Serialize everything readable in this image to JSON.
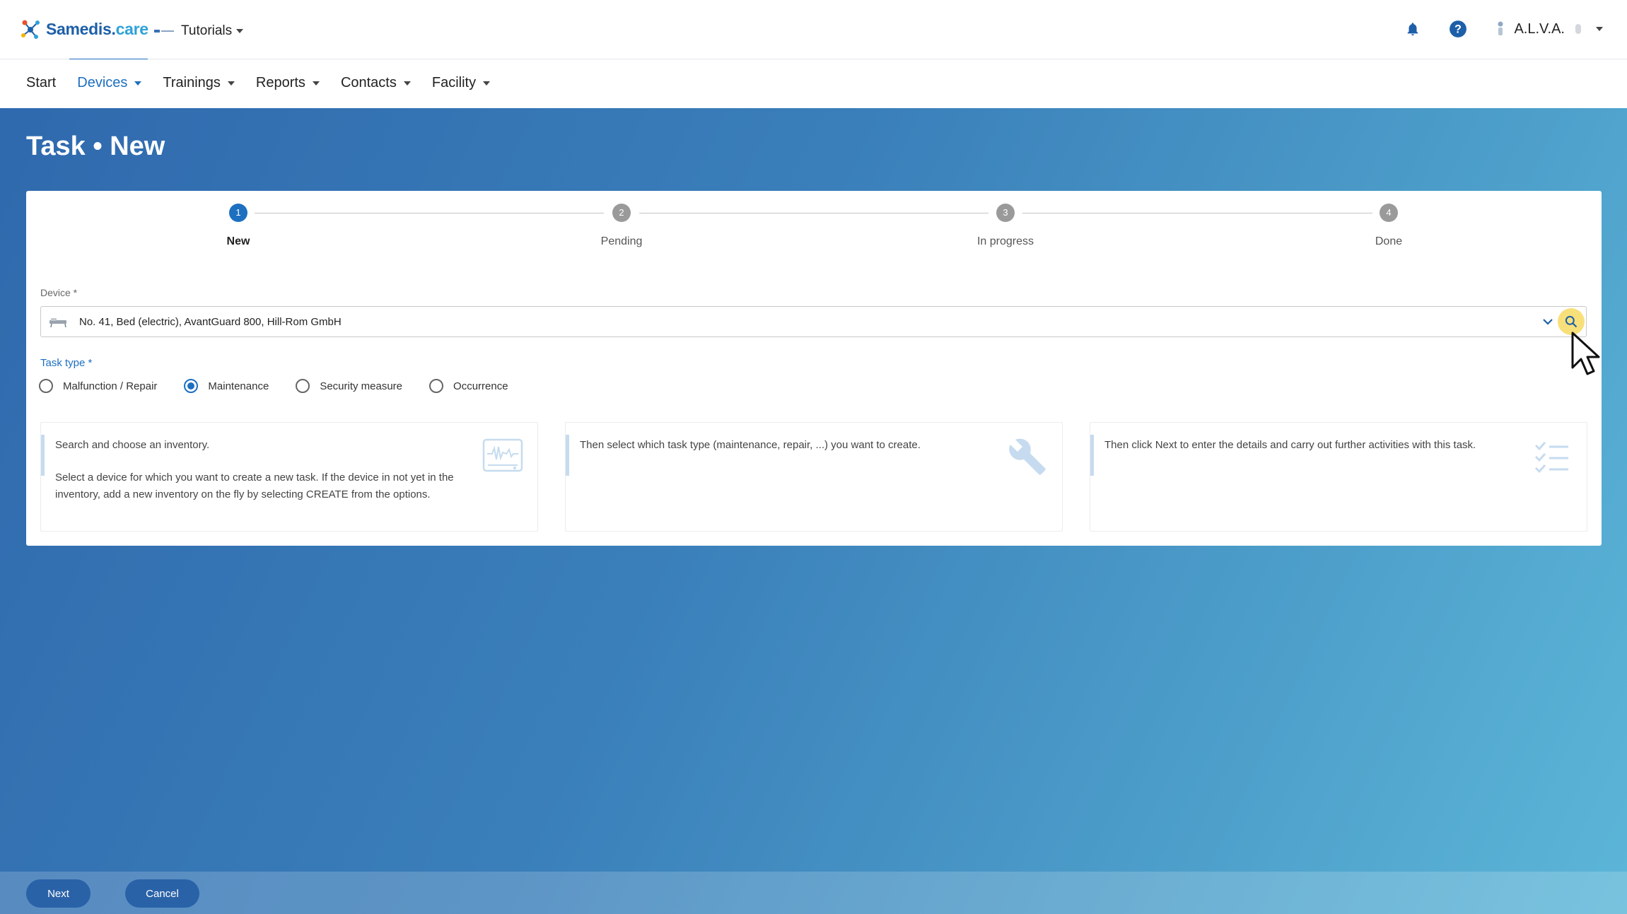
{
  "header": {
    "logo_name": "Samedis",
    "logo_dot": ".",
    "logo_suffix": "care",
    "tenant": "Tutorials",
    "user": "A.L.V.A.",
    "icons": [
      "bell-icon",
      "help-icon",
      "user-avatar-icon"
    ]
  },
  "nav": {
    "items": [
      {
        "label": "Start"
      },
      {
        "label": "Devices"
      },
      {
        "label": "Trainings"
      },
      {
        "label": "Reports"
      },
      {
        "label": "Contacts"
      },
      {
        "label": "Facility"
      }
    ]
  },
  "page": {
    "title": "Task • New"
  },
  "stepper": {
    "steps": [
      {
        "num": "1",
        "label": "New"
      },
      {
        "num": "2",
        "label": "Pending"
      },
      {
        "num": "3",
        "label": "In progress"
      },
      {
        "num": "4",
        "label": "Done"
      }
    ],
    "active_step": 1
  },
  "form": {
    "device_label": "Device *",
    "device_value": "No. 41, Bed (electric), AvantGuard 800, Hill-Rom GmbH",
    "task_type_label": "Task type *",
    "task_types": [
      {
        "label": "Malfunction / Repair",
        "checked": false
      },
      {
        "label": "Maintenance",
        "checked": true
      },
      {
        "label": "Security measure",
        "checked": false
      },
      {
        "label": "Occurrence",
        "checked": false
      }
    ]
  },
  "info": {
    "box1_p1": "Search and choose an inventory.",
    "box1_p2": "Select a device for which you want to create a new task. If the device in not yet in the inventory, add a new inventory on the fly by selecting CREATE from the options.",
    "box2": "Then select which task type (maintenance, repair, ...) you want to create.",
    "box3": "Then click Next to enter the details and carry out further activities with this task."
  },
  "footer": {
    "next": "Next",
    "cancel": "Cancel"
  },
  "colors": {
    "primary": "#1d6fc0",
    "search_highlight": "#f7e07a",
    "step_inactive": "#9a9a9a"
  }
}
